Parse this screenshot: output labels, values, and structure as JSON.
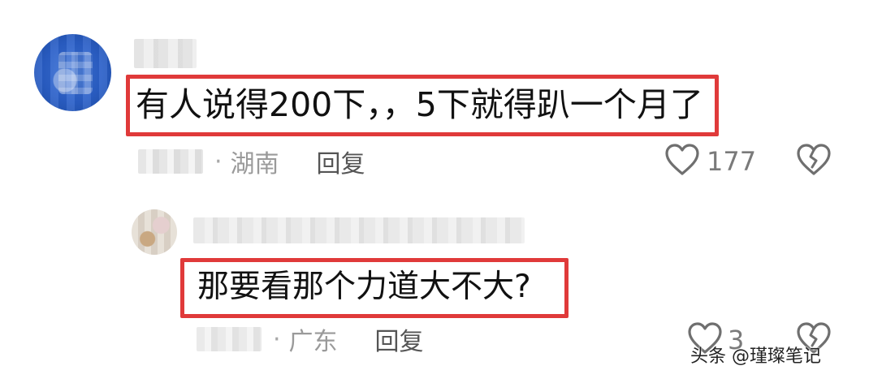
{
  "comments": [
    {
      "text": "有人说得200下，，5下就得趴一个月了",
      "location": "湖南",
      "reply_label": "回复",
      "like_count": "177",
      "separator": "·"
    },
    {
      "text": "那要看那个力道大不大?",
      "location": "广东",
      "reply_label": "回复",
      "like_count": "3",
      "separator": "·"
    }
  ],
  "icons": {
    "like": "heart-outline-icon",
    "dislike": "broken-heart-icon"
  },
  "colors": {
    "highlight_border": "#e03a3a",
    "meta_text": "#9a9a9a",
    "reply_text": "#555555",
    "main_avatar": "#2a5fc8"
  },
  "watermark": "头条 @瑾璨笔记"
}
